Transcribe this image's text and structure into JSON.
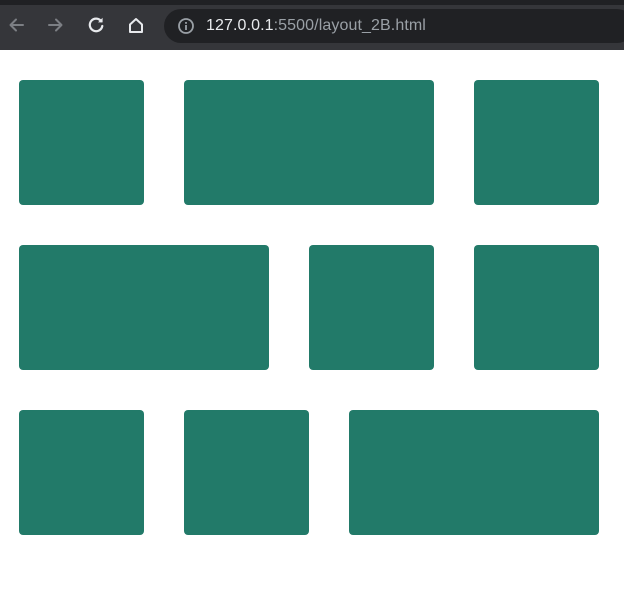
{
  "browser": {
    "url_host": "127.0.0.1",
    "url_rest": ":5500/layout_2B.html"
  },
  "layout": {
    "tile_color": "#227a69",
    "rows": [
      [
        "small",
        "wide",
        "small"
      ],
      [
        "wide",
        "small",
        "small"
      ],
      [
        "small",
        "small",
        "wide"
      ]
    ]
  }
}
